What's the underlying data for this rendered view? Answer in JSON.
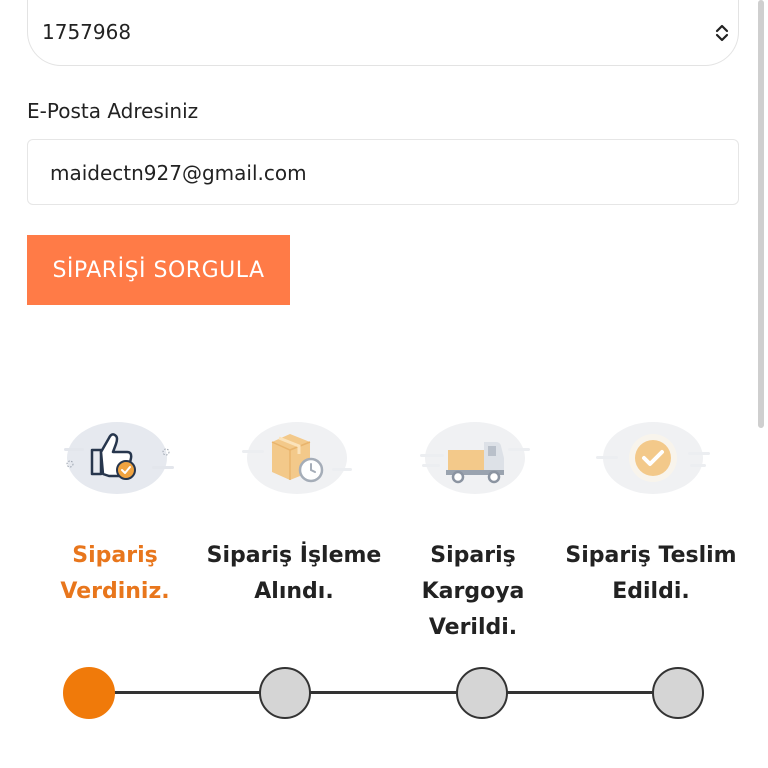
{
  "form": {
    "order_number": "1757968",
    "email_label": "E-Posta Adresiniz",
    "email_value": "maidectn927@gmail.com",
    "query_button": "SİPARİŞİ SORGULA"
  },
  "steps": [
    {
      "label": "Sipariş\nVerdiniz.",
      "icon": "thumbs-up-icon",
      "active": true
    },
    {
      "label": "Sipariş İşleme\nAlındı.",
      "icon": "package-clock-icon",
      "active": false
    },
    {
      "label": "Sipariş Kargoya\nVerildi.",
      "icon": "truck-icon",
      "active": false
    },
    {
      "label": "Sipariş Teslim\nEdildi.",
      "icon": "check-circle-icon",
      "active": false
    }
  ],
  "colors": {
    "accent": "#ff7b47",
    "active_step": "#e8761c",
    "active_dot": "#f07a0a",
    "inactive_dot": "#d5d5d5"
  }
}
